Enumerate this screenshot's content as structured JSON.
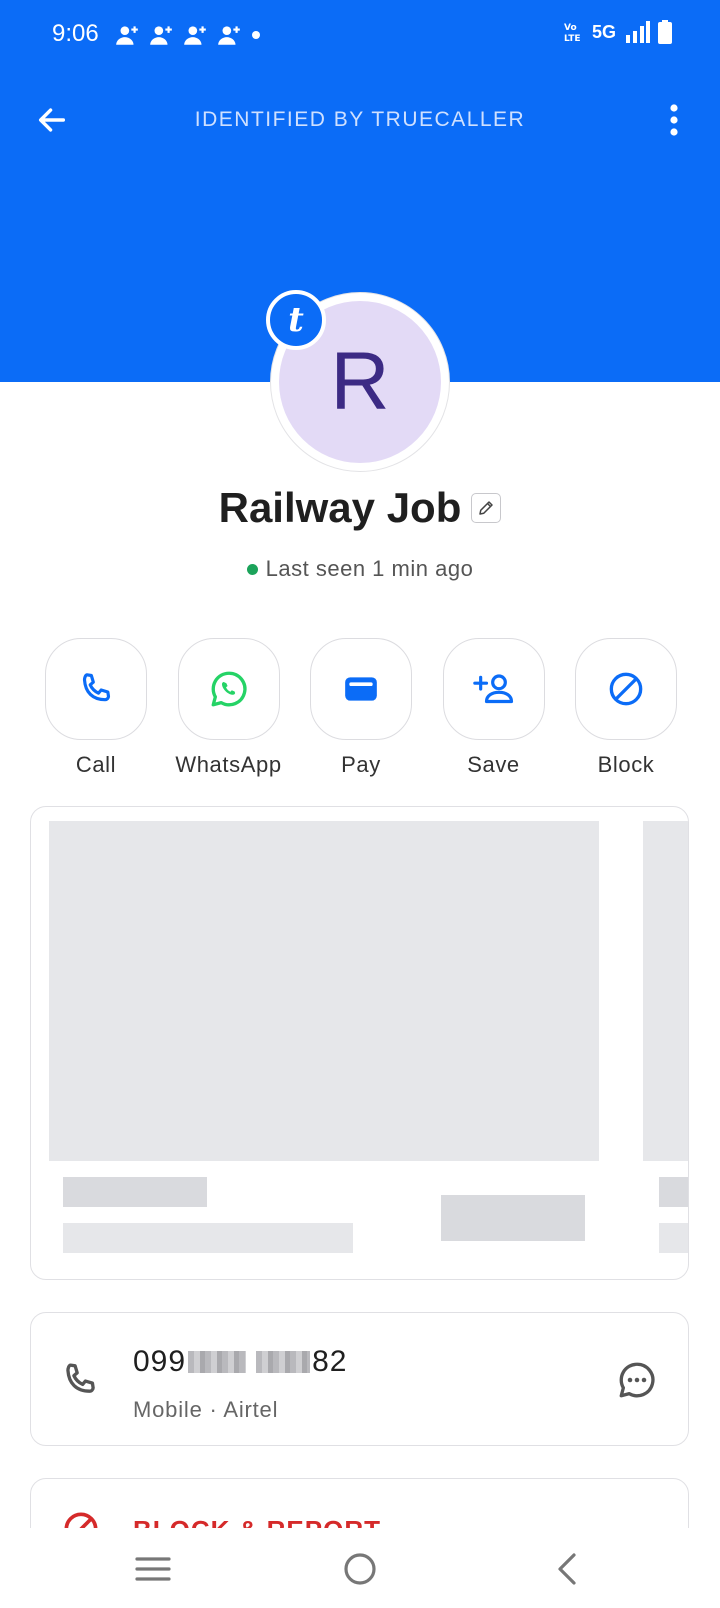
{
  "status_bar": {
    "time": "9:06",
    "network": "5G",
    "notification_icons": [
      "add-user-icon",
      "add-user-icon",
      "add-user-icon",
      "add-user-icon",
      "dot-icon"
    ]
  },
  "header": {
    "title": "IDENTIFIED BY TRUECALLER",
    "background_color": "#0B6CF7"
  },
  "profile": {
    "avatar_initial": "R",
    "badge_letter": "t",
    "name": "Railway Job",
    "last_seen": "Last seen 1 min ago",
    "avatar_bg": "#E3DAF6",
    "avatar_text_color": "#3C2A84"
  },
  "actions": [
    {
      "label": "Call",
      "icon": "phone-icon"
    },
    {
      "label": "WhatsApp",
      "icon": "whatsapp-icon"
    },
    {
      "label": "Pay",
      "icon": "wallet-icon"
    },
    {
      "label": "Save",
      "icon": "add-contact-icon"
    },
    {
      "label": "Block",
      "icon": "block-icon"
    }
  ],
  "number_card": {
    "number_prefix": "099",
    "number_suffix": "82",
    "subtitle": "Mobile · Airtel"
  },
  "block_card": {
    "label": "BLOCK & REPORT"
  },
  "colors": {
    "accent": "#0B6CF7",
    "whatsapp": "#25D366",
    "danger": "#D52A2A",
    "online": "#1BA35A"
  }
}
